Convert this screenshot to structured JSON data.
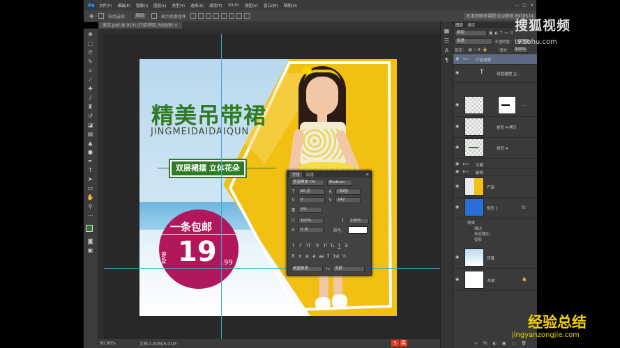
{
  "app": {
    "logo": "Ps",
    "menu": [
      "文件(F)",
      "编辑(E)",
      "图像(I)",
      "图层(L)",
      "类型(Y)",
      "选择(S)",
      "滤镜(T)",
      "3D(D)",
      "视图(V)",
      "窗口(W)",
      "帮助(H)"
    ],
    "window_controls": [
      "—",
      "▢",
      "✕"
    ]
  },
  "options_bar": {
    "auto_select_label": "自动选择：",
    "auto_select_value": "图层",
    "show_transform_label": "显示变换控件",
    "right_info": "孔老师图多课程 QQ/微信 8978514"
  },
  "document": {
    "tab_title": "鉴定.psd @ 91% (介绍说明, RGB/8) ×",
    "zoom": "90.96%",
    "doc_size": "文档:1.83M/9.01M"
  },
  "canvas": {
    "headline": "精美吊带裙",
    "pinyin": "JINGMEIDAIDAIQUN",
    "tagline": "双层裙摆 立体花朵",
    "free_shipping": "一条包邮",
    "currency": "RMB",
    "price": "19",
    "cents": ".99"
  },
  "char_panel": {
    "tabs": [
      "字符",
      "段落"
    ],
    "font_family": "思源黑体 CN",
    "font_style": "Medium",
    "size": "60 点",
    "leading": "(自动)",
    "kerning": "0",
    "tracking": "142",
    "scale_ratio": "0%",
    "vscale": "100%",
    "hscale": "100%",
    "baseline": "0 点",
    "color_label": "颜色：",
    "format_buttons": [
      "T",
      "T",
      "TT",
      "Tr",
      "T¹",
      "T₁",
      "T",
      "T"
    ],
    "extras": [
      "fi",
      "ơ",
      "st",
      "A",
      "aa",
      "T",
      "1st",
      "½"
    ],
    "language": "美国英语",
    "aa_label": "ªa",
    "antialias": "浑厚"
  },
  "layers_panel": {
    "tabs": [
      "图层",
      "通道"
    ],
    "kind": "类型",
    "blend_mode": "穿透",
    "opacity_label": "不透明度：",
    "opacity": "100%",
    "lock_label": "锁定：",
    "fill_label": "填充：",
    "fill": "100%",
    "layers": [
      {
        "name": "介绍说明",
        "type": "group"
      },
      {
        "name": "双层裙摆 立...",
        "type": "text"
      },
      {
        "name": "...",
        "type": "mask"
      },
      {
        "name": "矩形 4 拷贝",
        "type": "shape"
      },
      {
        "name": "矩形 4",
        "type": "shape"
      },
      {
        "name": "文案",
        "type": "group"
      },
      {
        "name": "装饰",
        "type": "group"
      },
      {
        "name": "产品",
        "type": "image"
      },
      {
        "name": "矩形 1",
        "type": "shape"
      },
      {
        "name": "效果",
        "type": "effects"
      },
      {
        "name": "描边",
        "type": "effect"
      },
      {
        "name": "渐变叠加",
        "type": "effect"
      },
      {
        "name": "投影",
        "type": "effect"
      },
      {
        "name": "背景",
        "type": "image"
      },
      {
        "name": "背景",
        "type": "locked"
      }
    ],
    "footer_icons": [
      "∞",
      "fx",
      "◐",
      "▣",
      "▭",
      "🗑"
    ]
  },
  "watermarks": {
    "sohu": "搜狐视频",
    "sohu_url": "tv.sohu.com",
    "jingyan": "经验总结",
    "jingyan_url": "jingyanzongjie.com"
  },
  "ime": [
    "S",
    "英"
  ],
  "colors": {
    "green": "#2f7a25",
    "magenta": "#b0185b",
    "yellow": "#f2c012",
    "guide": "#38a9d6"
  }
}
